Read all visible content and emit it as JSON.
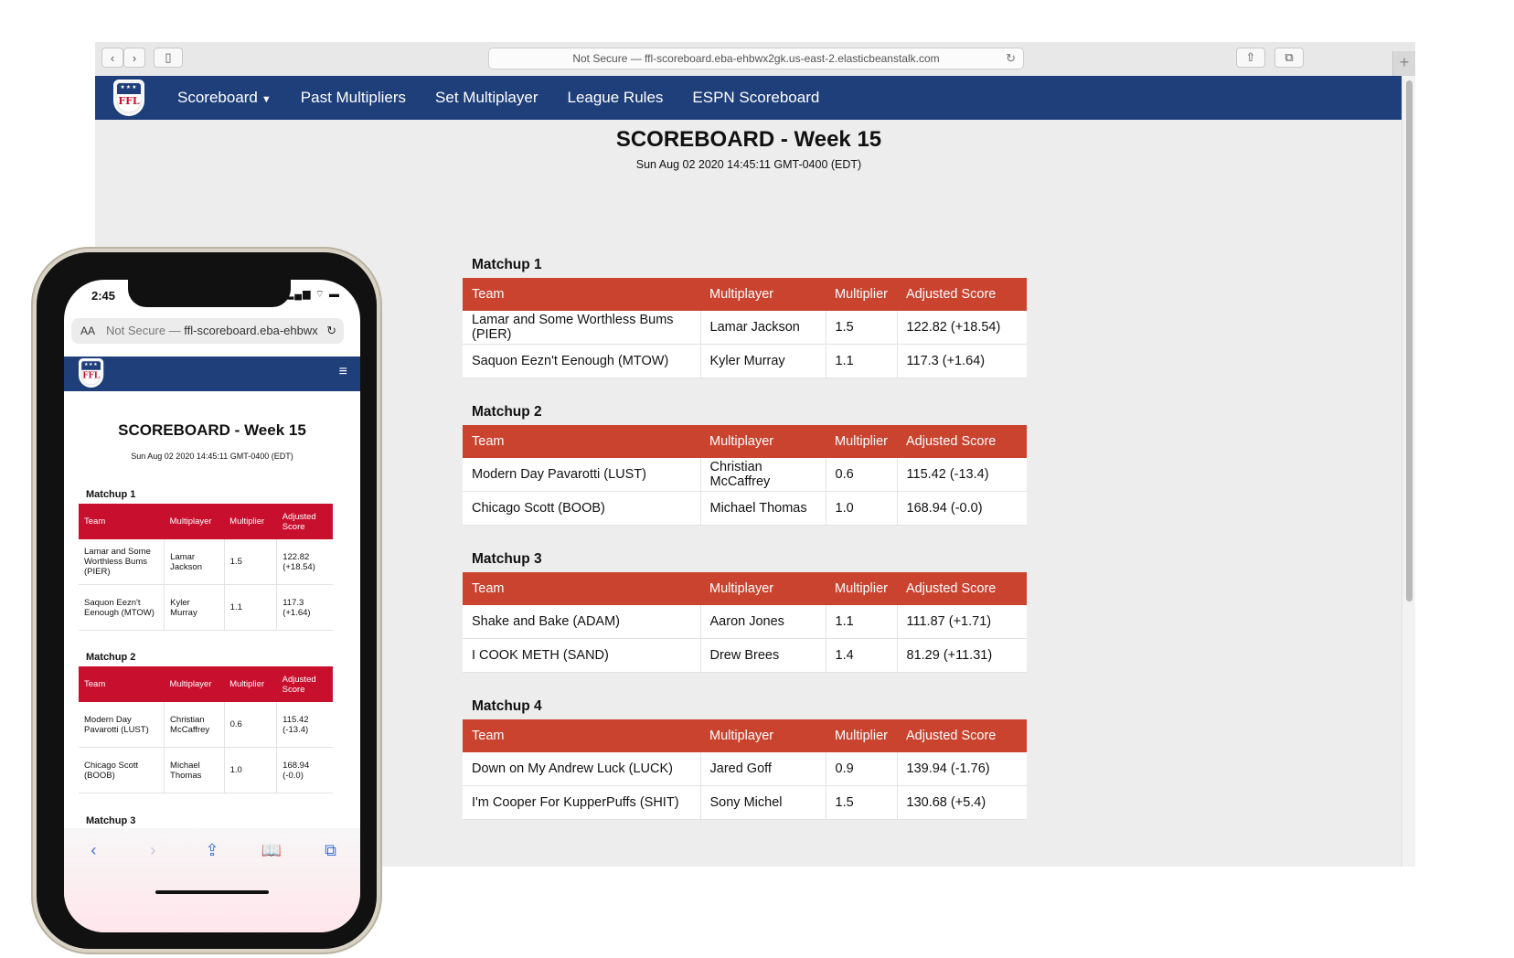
{
  "browser": {
    "address": "Not Secure — ffl-scoreboard.eba-ehbwx2gk.us-east-2.elasticbeanstalk.com",
    "back_icon": "chevron-left-icon",
    "forward_icon": "chevron-right-icon",
    "sidebar_icon": "sidebar-icon",
    "share_icon": "share-icon",
    "tabs_icon": "tabs-icon",
    "reload_glyph": "↻",
    "new_tab_glyph": "+"
  },
  "nav": {
    "logo_text": "FFL",
    "items": [
      {
        "label": "Scoreboard",
        "has_dropdown": true
      },
      {
        "label": "Past Multipliers"
      },
      {
        "label": "Set Multiplayer"
      },
      {
        "label": "League Rules"
      },
      {
        "label": "ESPN Scoreboard"
      }
    ],
    "color": "#1f3f7b"
  },
  "page": {
    "title": "SCOREBOARD - Week 15",
    "date": "Sun Aug 02 2020 14:45:11 GMT-0400 (EDT)"
  },
  "table_headers": [
    "Team",
    "Multiplayer",
    "Multiplier",
    "Adjusted Score"
  ],
  "header_color": "#c9432f",
  "matchups": [
    {
      "title": "Matchup 1",
      "rows": [
        [
          "Lamar and Some Worthless Bums (PIER)",
          "Lamar Jackson",
          "1.5",
          "122.82 (+18.54)"
        ],
        [
          "Saquon Eezn't Eenough (MTOW)",
          "Kyler Murray",
          "1.1",
          "117.3 (+1.64)"
        ]
      ]
    },
    {
      "title": "Matchup 2",
      "rows": [
        [
          "Modern Day Pavarotti (LUST)",
          "Christian McCaffrey",
          "0.6",
          "115.42 (-13.4)"
        ],
        [
          "Chicago Scott (BOOB)",
          "Michael Thomas",
          "1.0",
          "168.94 (-0.0)"
        ]
      ]
    },
    {
      "title": "Matchup 3",
      "rows": [
        [
          "Shake and Bake (ADAM)",
          "Aaron Jones",
          "1.1",
          "111.87 (+1.71)"
        ],
        [
          "I COOK METH (SAND)",
          "Drew Brees",
          "1.4",
          "81.29 (+11.31)"
        ]
      ]
    },
    {
      "title": "Matchup 4",
      "rows": [
        [
          "Down on My Andrew Luck (LUCK)",
          "Jared Goff",
          "0.9",
          "139.94 (-1.76)"
        ],
        [
          "I'm Cooper For KupperPuffs (SHIT)",
          "Sony Michel",
          "1.5",
          "130.68 (+5.4)"
        ]
      ]
    }
  ],
  "phone": {
    "time": "2:45",
    "status": "▂▄▆ ⌔ ▬",
    "aa": "AA",
    "addr_prefix": "Not Secure — ",
    "addr_host": "ffl-scoreboard.eba-ehbwx",
    "burger": "≡",
    "title": "SCOREBOARD - Week 15",
    "date": "Sun Aug 02 2020 14:45:11 GMT-0400 (EDT)",
    "headers": [
      "Team",
      "Multiplayer",
      "Multiplier",
      "Adjusted Score"
    ],
    "matchups": [
      {
        "title": "Matchup 1",
        "rows": [
          [
            "Lamar and Some Worthless Bums (PIER)",
            "Lamar Jackson",
            "1.5",
            "122.82 (+18.54)"
          ],
          [
            "Saquon Eezn't Eenough (MTOW)",
            "Kyler Murray",
            "1.1",
            "117.3 (+1.64)"
          ]
        ]
      },
      {
        "title": "Matchup 2",
        "rows": [
          [
            "Modern Day Pavarotti (LUST)",
            "Christian McCaffrey",
            "0.6",
            "115.42 (-13.4)"
          ],
          [
            "Chicago Scott (BOOB)",
            "Michael Thomas",
            "1.0",
            "168.94 (-0.0)"
          ]
        ]
      }
    ],
    "matchup3_title": "Matchup 3",
    "tabs": [
      {
        "icon": "back-icon",
        "glyph": "‹",
        "disabled": false
      },
      {
        "icon": "forward-icon",
        "glyph": "›",
        "disabled": true
      },
      {
        "icon": "share-icon",
        "glyph": "⇪",
        "disabled": false
      },
      {
        "icon": "bookmarks-icon",
        "glyph": "📖",
        "disabled": false
      },
      {
        "icon": "tabs-icon",
        "glyph": "⧉",
        "disabled": false
      }
    ]
  }
}
